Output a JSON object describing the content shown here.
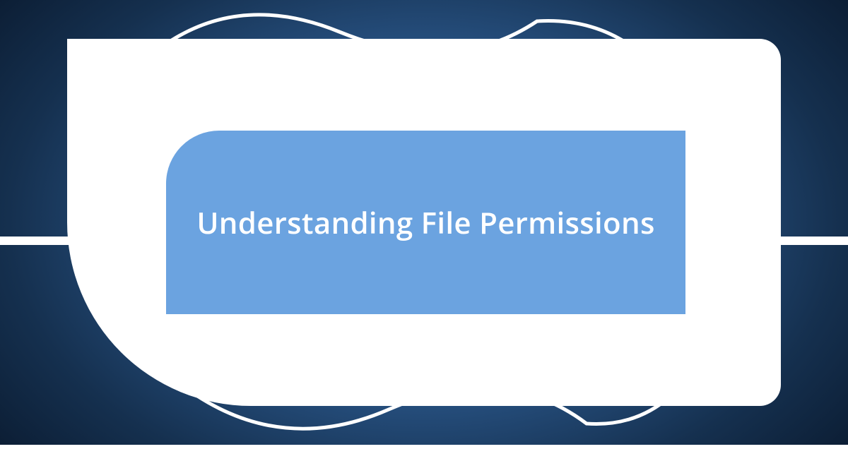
{
  "title": "Understanding File Permissions",
  "colors": {
    "inner_bg": "#6ba3e0",
    "outer_bg": "#ffffff",
    "text": "#ffffff"
  }
}
